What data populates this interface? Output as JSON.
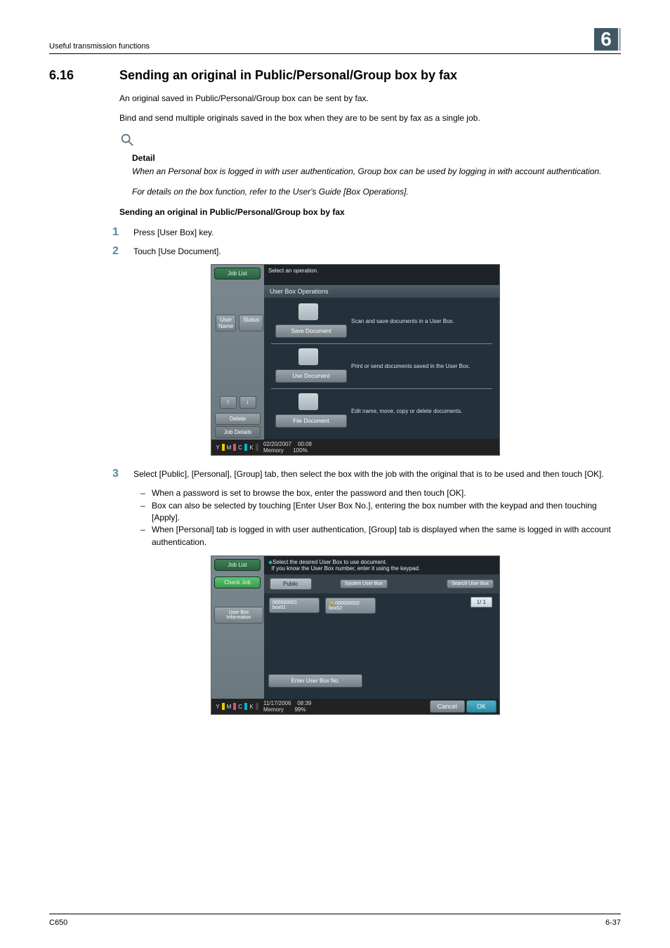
{
  "header": {
    "left": "Useful transmission functions",
    "chapter": "6"
  },
  "section": {
    "number": "6.16",
    "title": "Sending an original in Public/Personal/Group box by fax",
    "p1": "An original saved in Public/Personal/Group box can be sent by fax.",
    "p2": "Bind and send multiple originals saved in the box when they are to be sent by fax as a single job.",
    "detail_label": "Detail",
    "detail_p1": "When an Personal box is logged in with user authentication, Group box can be used by logging in with account authentication.",
    "detail_p2": "For details on the box function, refer to the User's Guide [Box Operations].",
    "sub_heading": "Sending an original in Public/Personal/Group box by fax"
  },
  "steps": {
    "s1": {
      "num": "1",
      "text": "Press [User Box] key."
    },
    "s2": {
      "num": "2",
      "text": "Touch [Use Document]."
    },
    "s3": {
      "num": "3",
      "text": "Select [Public], [Personal], [Group] tab, then select the box with the job with the original that is to be used and then touch [OK].",
      "bullets": [
        "When a password is set to browse the box, enter the password and then touch [OK].",
        "Box can also be selected by touching [Enter User Box No.], entering the box number with the keypad and then touching [Apply].",
        "When [Personal] tab is logged in with user authentication, [Group] tab is displayed when the same is logged in with account authentication."
      ]
    }
  },
  "screenshot1": {
    "job_list": "Job List",
    "select_op": "Select an operation.",
    "panel_title": "User Box Operations",
    "user_name": "User Name",
    "status": "Status",
    "save_doc": "Save Document",
    "save_desc": "Scan and save documents in a User Box.",
    "use_doc": "Use Document",
    "use_desc": "Print or send documents saved in the User Box.",
    "file_doc": "File Document",
    "file_desc": "Edit name, move, copy or delete documents.",
    "delete": "Delete",
    "job_details": "Job Details",
    "date": "02/20/2007",
    "time": "00:08",
    "memory": "Memory",
    "mem_pct": "100%"
  },
  "screenshot2": {
    "job_list": "Job List",
    "check_job": "Check Job",
    "user_box_info": "User Box Information",
    "instr1": "Select the desired User Box to use document.",
    "instr2": "If you know the User Box number, enter it using the keypad.",
    "public": "Public",
    "system_ub": "System User Box",
    "search_ub": "Search User Box",
    "box1_no": "000000001",
    "box1_name": "box01",
    "box2_no": "000000002",
    "box2_name": "box02",
    "page_ind": "1/  1",
    "enter_no": "Enter User Box No.",
    "cancel": "Cancel",
    "ok": "OK",
    "date": "11/17/2006",
    "time": "08:39",
    "memory": "Memory",
    "mem_pct": "99%"
  },
  "footer": {
    "left": "C650",
    "right": "6-37"
  }
}
